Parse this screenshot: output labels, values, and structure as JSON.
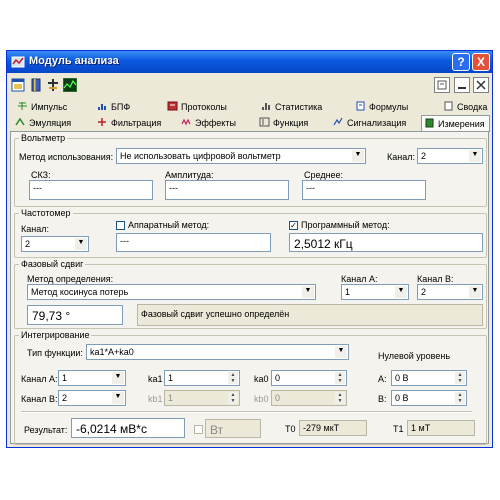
{
  "window": {
    "title": "Модуль анализа",
    "help": "?",
    "close": "X"
  },
  "tabs_row1": [
    "Импульс",
    "БПФ",
    "Протоколы",
    "Статистика",
    "Формулы",
    "Сводка"
  ],
  "tabs_row2": [
    "Эмуляция",
    "Фильтрация",
    "Эффекты",
    "Функция",
    "Сигнализация",
    "Измерения"
  ],
  "voltmeter": {
    "title": "Вольтметр",
    "method_label": "Метод использования:",
    "method_value": "Не использовать цифровой вольтметр",
    "channel_label": "Канал:",
    "channel_value": "2",
    "rms_label": "СКЗ:",
    "rms_value": "---",
    "amp_label": "Амплитуда:",
    "amp_value": "---",
    "avg_label": "Среднее:",
    "avg_value": "---"
  },
  "freq": {
    "title": "Частотомер",
    "channel_label": "Канал:",
    "channel_value": "2",
    "hw_label": "Аппаратный метод:",
    "hw_checked": false,
    "hw_value": "---",
    "sw_label": "Программный метод:",
    "sw_checked": true,
    "sw_value": "2,5012 кГц"
  },
  "phase": {
    "title": "Фазовый сдвиг",
    "method_label": "Метод определения:",
    "method_value": "Метод косинуса потерь",
    "chA_label": "Канал A:",
    "chA_value": "1",
    "chB_label": "Канал B:",
    "chB_value": "2",
    "result": "79,73 °",
    "message": "Фазовый сдвиг успешно определён"
  },
  "integr": {
    "title": "Интегрирование",
    "func_label": "Тип функции:",
    "func_value": "ka1*A+ka0",
    "zero_label": "Нулевой уровень",
    "chA_label": "Канал A:",
    "chA_value": "1",
    "chB_label": "Канал B:",
    "chB_value": "2",
    "ka1_label": "ka1",
    "ka1_value": "1",
    "kb1_label": "kb1",
    "kb1_value": "1",
    "ka0_label": "ka0",
    "ka0_value": "0",
    "kb0_label": "kb0",
    "kb0_value": "0",
    "zA_label": "A:",
    "zA_value": "0 В",
    "zB_label": "B:",
    "zB_value": "0 В",
    "result_label": "Результат:",
    "result_value": "-6,0214 мВ*с",
    "unit_value": "Вт",
    "t0_label": "T0",
    "t0_value": "-279 мкТ",
    "t1_label": "T1",
    "t1_value": "1 мТ"
  }
}
